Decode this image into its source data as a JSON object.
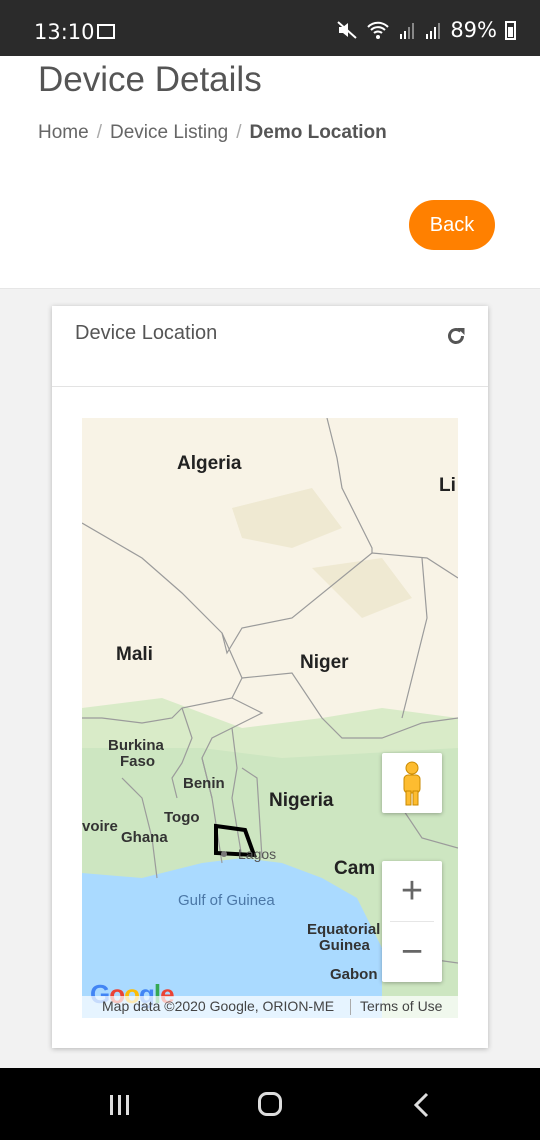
{
  "status": {
    "time": "13:10",
    "battery": "89%",
    "icons": [
      "gallery-icon",
      "mute-icon",
      "wifi-icon",
      "roaming-signal-icon",
      "signal-icon",
      "battery-icon"
    ]
  },
  "page": {
    "title": "Device Details",
    "breadcrumb": [
      "Home",
      "Device Listing",
      "Demo Location"
    ],
    "breadcrumb_separator": "/",
    "back_label": "Back"
  },
  "card": {
    "title": "Device Location",
    "refresh_icon": "refresh-icon"
  },
  "map": {
    "labels": {
      "algeria": "Algeria",
      "libya": "Li",
      "mali": "Mali",
      "niger": "Niger",
      "burkina": "Burkina",
      "faso": "Faso",
      "benin": "Benin",
      "togo": "Togo",
      "nigeria": "Nigeria",
      "ivoire": "voire",
      "ghana": "Ghana",
      "lagos": "Lagos",
      "cameroon": "Cam",
      "gulf": "Gulf of Guinea",
      "equatorial": "Equatorial",
      "guinea": "Guinea",
      "gabon": "Gabon"
    },
    "zoom_in": "+",
    "zoom_out": "−",
    "attribution": "Map data ©2020 Google, ORION-ME",
    "terms": "Terms of Use",
    "logo": "Google"
  },
  "colors": {
    "accent": "#ff8000",
    "statusbar": "#2b2b2b",
    "water": "#aadaff",
    "land": "#f8f3e6",
    "vegetation": "#cde6c1"
  }
}
